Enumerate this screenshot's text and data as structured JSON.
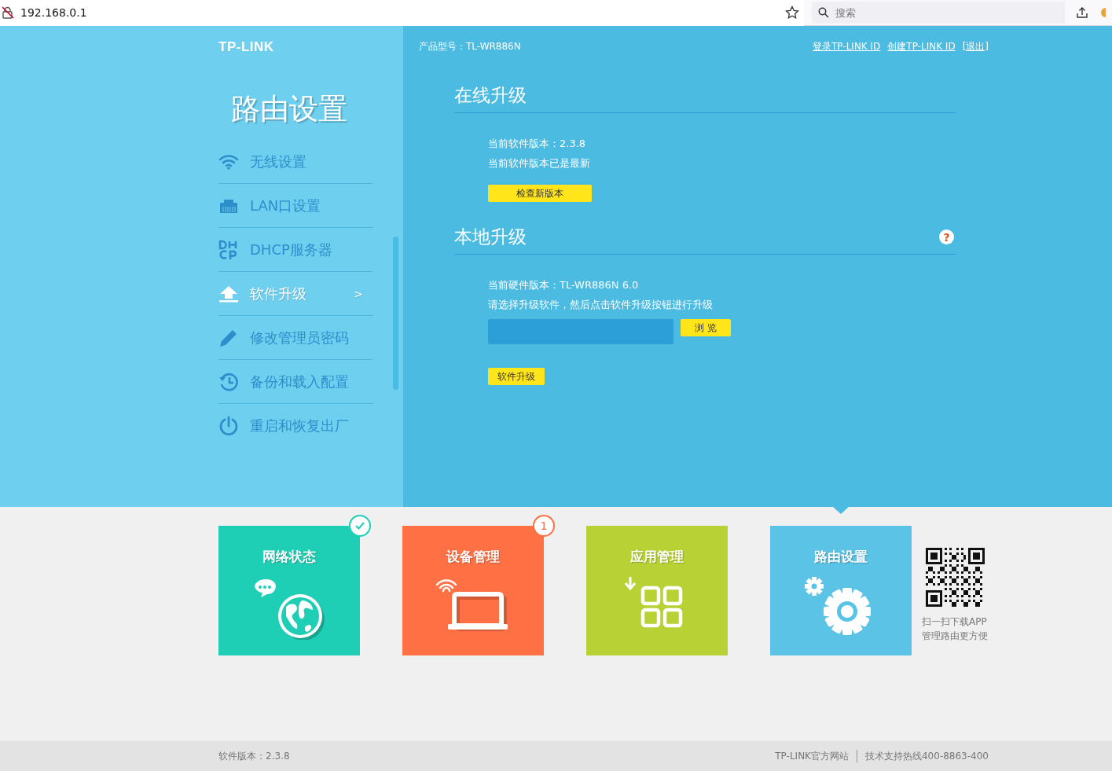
{
  "browser": {
    "address": "192.168.0.1",
    "search_placeholder": "搜索"
  },
  "sidebar": {
    "logo": "TP-LINK",
    "title": "路由设置",
    "caret": ">",
    "items": [
      {
        "kind": "wifi",
        "label": "无线设置",
        "selected": false
      },
      {
        "kind": "lan",
        "label": "LAN口设置",
        "selected": false
      },
      {
        "kind": "dhcp",
        "label": "DHCP服务器",
        "selected": false
      },
      {
        "kind": "upload",
        "label": "软件升级",
        "selected": true
      },
      {
        "kind": "pencil",
        "label": "修改管理员密码",
        "selected": false
      },
      {
        "kind": "history",
        "label": "备份和载入配置",
        "selected": false
      },
      {
        "kind": "power",
        "label": "重启和恢复出厂",
        "selected": false
      }
    ]
  },
  "header": {
    "model": "产品型号：TL-WR886N",
    "links": [
      "登录TP-LINK ID",
      "创建TP-LINK ID",
      "[退出]"
    ]
  },
  "online_upgrade": {
    "title": "在线升级",
    "lines": [
      "当前软件版本：2.3.8",
      "当前软件版本已是最新"
    ],
    "button": "检查新版本"
  },
  "local_upgrade": {
    "title": "本地升级",
    "help": "?",
    "lines": [
      "当前硬件版本：TL-WR886N 6.0",
      "请选择升级软件，然后点击软件升级按钮进行升级"
    ],
    "browse_button": "浏 览",
    "upgrade_button": "软件升级"
  },
  "tiles": [
    {
      "kind": "globe",
      "label": "网络状态",
      "color": "#1fcfb5",
      "badge": {
        "kind": "check"
      },
      "selected": false
    },
    {
      "kind": "laptop",
      "label": "设备管理",
      "color": "#ff7145",
      "badge": {
        "kind": "count",
        "text": "1"
      },
      "selected": false
    },
    {
      "kind": "apps",
      "label": "应用管理",
      "color": "#b8d134",
      "selected": false
    },
    {
      "kind": "gear",
      "label": "路由设置",
      "color": "#5bc3e6",
      "selected": true
    }
  ],
  "qr": {
    "caption": [
      "扫一扫下载APP",
      "管理路由更方便"
    ]
  },
  "footer": {
    "version": "软件版本：2.3.8",
    "links": [
      "TP-LINK官方网站",
      "技术支持热线400-8863-400"
    ]
  }
}
